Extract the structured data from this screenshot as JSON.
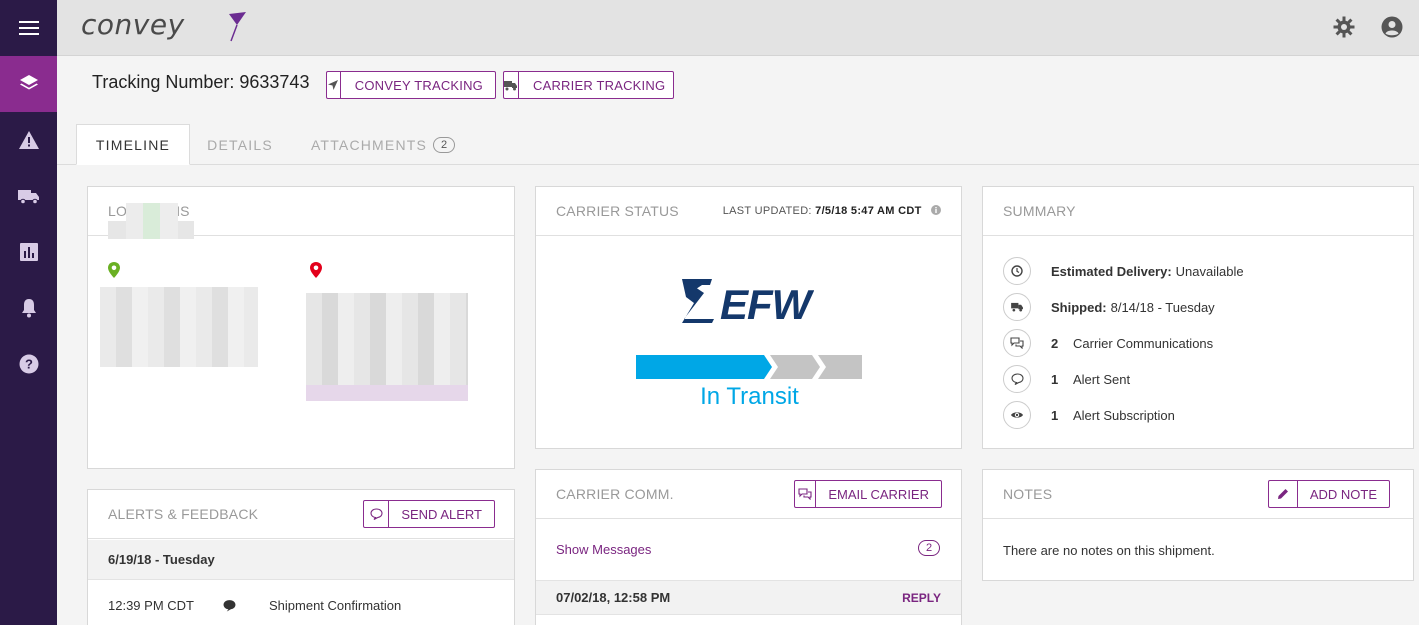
{
  "app": {
    "logo": "convey"
  },
  "sidebar": {
    "items": [
      {
        "icon": "menu-icon"
      },
      {
        "icon": "layers-icon",
        "active": true
      },
      {
        "icon": "warning-icon"
      },
      {
        "icon": "truck-icon"
      },
      {
        "icon": "chart-icon"
      },
      {
        "icon": "bell-icon"
      },
      {
        "icon": "help-icon"
      }
    ]
  },
  "header": {
    "tracking_label": "Tracking Number: 9633743",
    "convey_tracking": "CONVEY TRACKING",
    "carrier_tracking": "CARRIER TRACKING"
  },
  "tabs": [
    {
      "label": "TIMELINE",
      "active": true
    },
    {
      "label": "DETAILS"
    },
    {
      "label": "ATTACHMENTS",
      "badge": "2"
    }
  ],
  "locations": {
    "title": "LOCATIONS"
  },
  "carrier_status": {
    "title": "CARRIER STATUS",
    "updated_label": "LAST UPDATED:",
    "updated_value": "7/5/18 5:47 AM CDT",
    "carrier_logo": "EFW",
    "status": "In Transit",
    "progress_steps_completed": 1,
    "progress_steps_total": 3
  },
  "summary": {
    "title": "SUMMARY",
    "estimated_label": "Estimated Delivery:",
    "estimated_value": "Unavailable",
    "shipped_label": "Shipped:",
    "shipped_value": "8/14/18 - Tuesday",
    "comms_count": "2",
    "comms_label": "Carrier Communications",
    "alert_sent_count": "1",
    "alert_sent_label": "Alert Sent",
    "alert_sub_count": "1",
    "alert_sub_label": "Alert Subscription"
  },
  "alerts": {
    "title": "ALERTS & FEEDBACK",
    "send_alert": "SEND ALERT",
    "date": "6/19/18 - Tuesday",
    "entry_time": "12:39 PM CDT",
    "entry_text": "Shipment Confirmation"
  },
  "carrier_comm": {
    "title": "CARRIER COMM.",
    "email_carrier": "EMAIL CARRIER",
    "show_messages": "Show Messages",
    "count": "2",
    "message_time": "07/02/18, 12:58 PM",
    "reply": "REPLY"
  },
  "notes": {
    "title": "NOTES",
    "add_note": "ADD NOTE",
    "empty_text": "There are no notes on this shipment."
  },
  "colors": {
    "sidebar": "#2b1a47",
    "accent": "#8a2c8f",
    "progress_active": "#00a7e6",
    "progress_inactive": "#c4c4c4",
    "efw_blue": "#14386b",
    "origin_pin": "#6ab023",
    "dest_pin": "#e3001b"
  }
}
